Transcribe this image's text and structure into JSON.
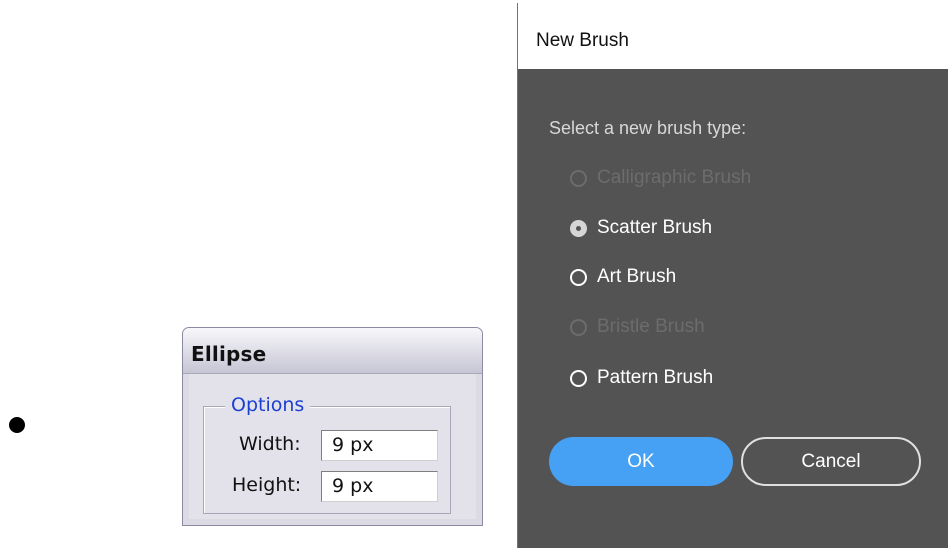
{
  "ellipse_dialog": {
    "title": "Ellipse",
    "group_label": "Options",
    "width_label": "Width:",
    "width_value": "9 px",
    "height_label": "Height:",
    "height_value": "9 px"
  },
  "new_brush_dialog": {
    "title": "New Brush",
    "prompt": "Select a new brush type:",
    "options": [
      {
        "label": "Calligraphic Brush",
        "enabled": false,
        "selected": false
      },
      {
        "label": "Scatter Brush",
        "enabled": true,
        "selected": true
      },
      {
        "label": "Art Brush",
        "enabled": true,
        "selected": false
      },
      {
        "label": "Bristle Brush",
        "enabled": false,
        "selected": false
      },
      {
        "label": "Pattern Brush",
        "enabled": true,
        "selected": false
      }
    ],
    "ok_label": "OK",
    "cancel_label": "Cancel"
  },
  "colors": {
    "dialog_background": "#535353",
    "ok_accent": "#46a1f4",
    "options_legend": "#1a3fd1"
  }
}
